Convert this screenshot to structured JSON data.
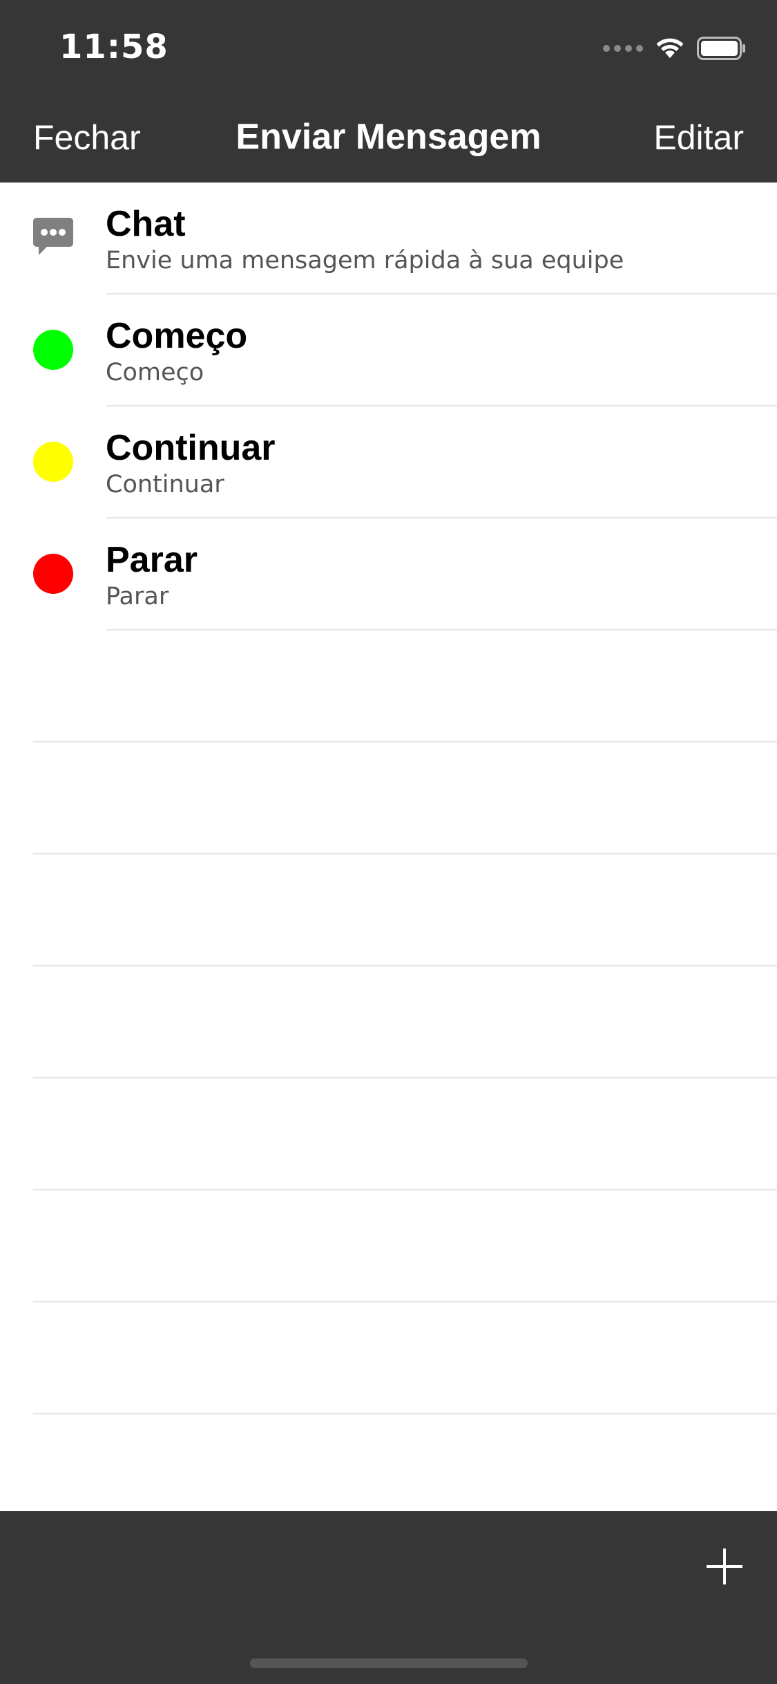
{
  "status_bar": {
    "time": "11:58"
  },
  "nav": {
    "left_label": "Fechar",
    "title": "Enviar Mensagem",
    "right_label": "Editar"
  },
  "messages": [
    {
      "title": "Chat",
      "subtitle": "Envie uma mensagem rápida à sua equipe",
      "icon": "chat-bubble-icon",
      "color": "#808080"
    },
    {
      "title": "Começo",
      "subtitle": "Começo",
      "icon": "green-status-dot-icon",
      "color": "#00ff00"
    },
    {
      "title": "Continuar",
      "subtitle": "Continuar",
      "icon": "yellow-status-dot-icon",
      "color": "#ffff00"
    },
    {
      "title": "Parar",
      "subtitle": "Parar",
      "icon": "red-status-dot-icon",
      "color": "#ff0000"
    }
  ],
  "toolbar": {
    "add_icon": "plus-icon"
  },
  "colors": {
    "bar_background": "#363636",
    "bar_text": "#ffffff",
    "separator": "#e6e6e6"
  }
}
